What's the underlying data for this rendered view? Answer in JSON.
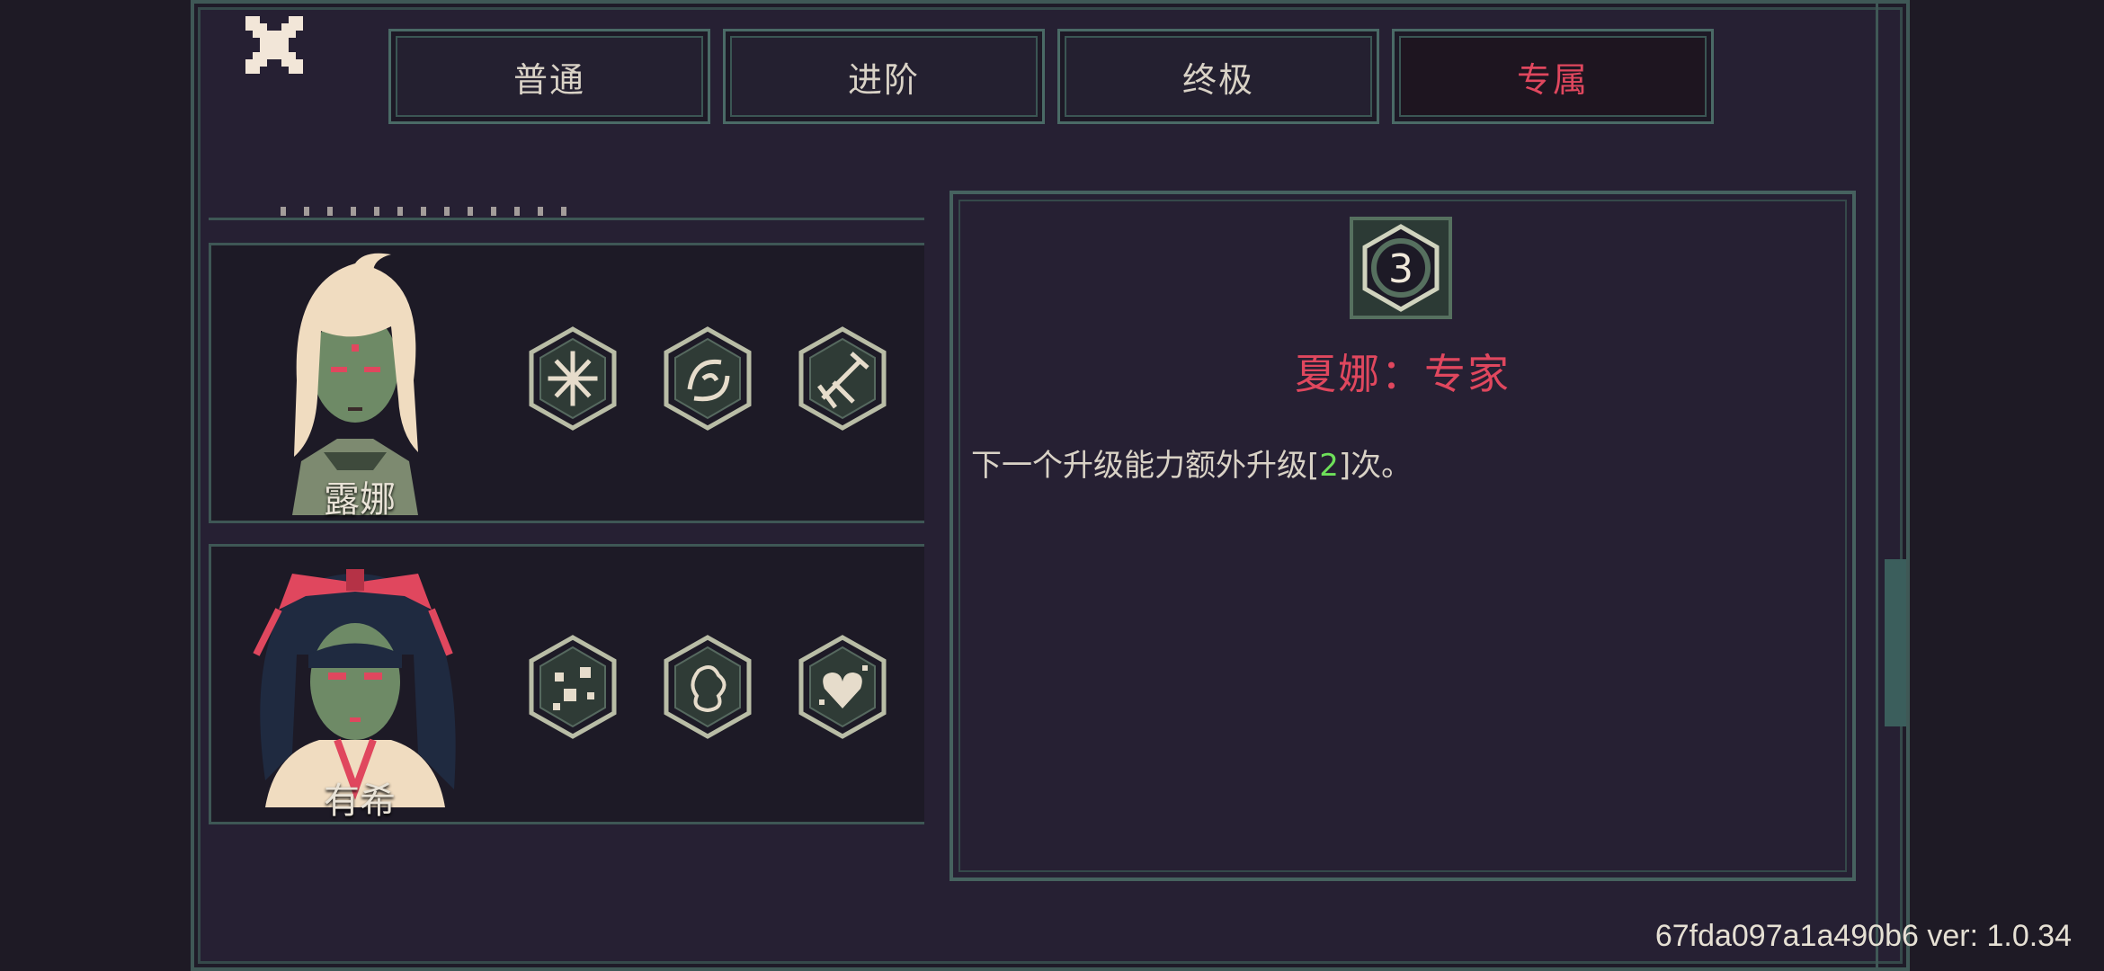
{
  "tabs": [
    {
      "label": "普通",
      "active": false
    },
    {
      "label": "进阶",
      "active": false
    },
    {
      "label": "终极",
      "active": false
    },
    {
      "label": "专属",
      "active": true
    }
  ],
  "characters": [
    {
      "name": "露娜",
      "skills": [
        "starburst-skill-icon",
        "swirl-skill-icon",
        "comet-skill-icon"
      ]
    },
    {
      "name": "有希",
      "skills": [
        "bloom-skill-icon",
        "spirit-skill-icon",
        "heart-skill-icon"
      ]
    }
  ],
  "detail": {
    "icon_number": "3",
    "title": "夏娜：专家",
    "desc_before": "下一个升级能力额外升级[",
    "desc_value": "2",
    "desc_after": "]次。"
  },
  "footer": {
    "version": "67fda097a1a490b6 ver: 1.0.34"
  },
  "colors": {
    "accent": "#e0475e",
    "frame": "#4a6a66",
    "value_green": "#6ee05a"
  }
}
